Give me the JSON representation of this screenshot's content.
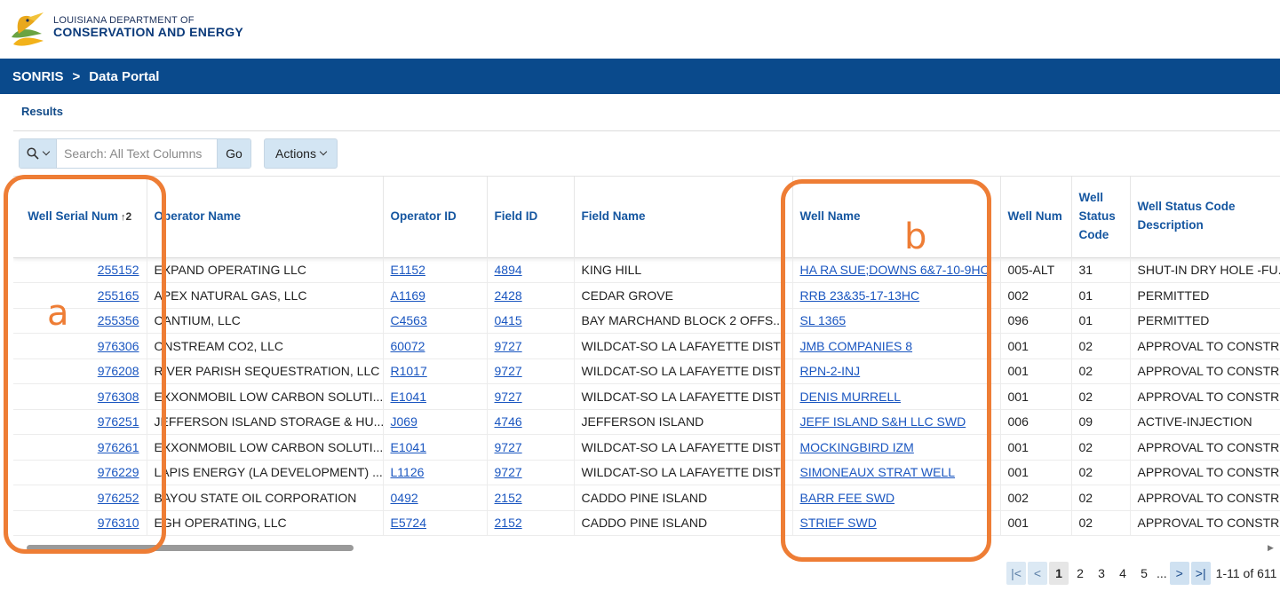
{
  "header": {
    "org_line1": "LOUISIANA DEPARTMENT OF",
    "org_line2": "CONSERVATION AND ENERGY"
  },
  "nav": {
    "crumb1": "SONRIS",
    "separator": ">",
    "crumb2": "Data Portal"
  },
  "region_title": "Results",
  "toolbar": {
    "search_placeholder": "Search: All Text Columns",
    "go_label": "Go",
    "actions_label": "Actions"
  },
  "table": {
    "columns": [
      "Well Serial Num",
      "Operator Name",
      "Operator ID",
      "Field ID",
      "Field Name",
      "Well Name",
      "Well Num",
      "Well Status Code",
      "Well Status Code Description"
    ],
    "sort_indicator": "↑",
    "sort_order": "2",
    "rows": [
      [
        "255152",
        "EXPAND OPERATING LLC",
        "E1152",
        "4894",
        "KING HILL",
        "HA RA SUE;DOWNS 6&7-10-9HC",
        "005-ALT",
        "31",
        "SHUT-IN DRY HOLE -FU..."
      ],
      [
        "255165",
        "APEX NATURAL GAS, LLC",
        "A1169",
        "2428",
        "CEDAR GROVE",
        "RRB 23&35-17-13HC",
        "002",
        "01",
        "PERMITTED"
      ],
      [
        "255356",
        "CANTIUM, LLC",
        "C4563",
        "0415",
        "BAY MARCHAND BLOCK 2 OFFS...",
        "SL 1365",
        "096",
        "01",
        "PERMITTED"
      ],
      [
        "976306",
        "ONSTREAM CO2, LLC",
        "60072",
        "9727",
        "WILDCAT-SO LA LAFAYETTE DIST",
        "JMB COMPANIES 8",
        "001",
        "02",
        "APPROVAL TO CONSTR..."
      ],
      [
        "976208",
        "RIVER PARISH SEQUESTRATION, LLC",
        "R1017",
        "9727",
        "WILDCAT-SO LA LAFAYETTE DIST",
        "RPN-2-INJ",
        "001",
        "02",
        "APPROVAL TO CONSTR..."
      ],
      [
        "976308",
        "EXXONMOBIL LOW CARBON SOLUTI...",
        "E1041",
        "9727",
        "WILDCAT-SO LA LAFAYETTE DIST",
        "DENIS MURRELL",
        "001",
        "02",
        "APPROVAL TO CONSTR..."
      ],
      [
        "976251",
        "JEFFERSON ISLAND STORAGE & HU...",
        "J069",
        "4746",
        "JEFFERSON ISLAND",
        "JEFF ISLAND S&H LLC SWD",
        "006",
        "09",
        "ACTIVE-INJECTION"
      ],
      [
        "976261",
        "EXXONMOBIL LOW CARBON SOLUTI...",
        "E1041",
        "9727",
        "WILDCAT-SO LA LAFAYETTE DIST",
        "MOCKINGBIRD IZM",
        "001",
        "02",
        "APPROVAL TO CONSTR..."
      ],
      [
        "976229",
        "LAPIS ENERGY (LA DEVELOPMENT) ...",
        "L1126",
        "9727",
        "WILDCAT-SO LA LAFAYETTE DIST",
        "SIMONEAUX STRAT WELL",
        "001",
        "02",
        "APPROVAL TO CONSTR..."
      ],
      [
        "976252",
        "BAYOU STATE OIL CORPORATION",
        "0492",
        "2152",
        "CADDO PINE ISLAND",
        "BARR FEE SWD",
        "002",
        "02",
        "APPROVAL TO CONSTR..."
      ],
      [
        "976310",
        "EGH OPERATING, LLC",
        "E5724",
        "2152",
        "CADDO PINE ISLAND",
        "STRIEF SWD",
        "001",
        "02",
        "APPROVAL TO CONSTR..."
      ]
    ]
  },
  "pagination": {
    "first": "|<",
    "prev": "<",
    "pages": [
      "1",
      "2",
      "3",
      "4",
      "5"
    ],
    "ellipsis": "...",
    "next": ">",
    "last": ">|",
    "info": "1-11 of 611"
  },
  "annotations": {
    "a": "a",
    "b": "b"
  },
  "colors": {
    "nav": "#0a4a8c",
    "header_text": "#1556a0",
    "link": "#1a56c0",
    "annotation": "#ee7d35",
    "button": "#d3e5f3"
  }
}
